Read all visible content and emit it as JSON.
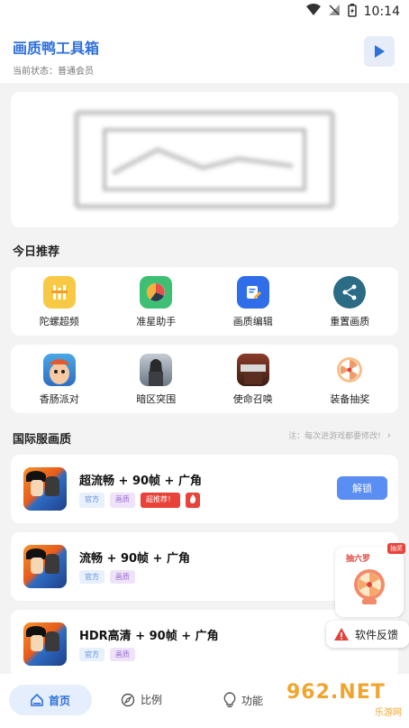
{
  "status_bar": {
    "time": "10:14"
  },
  "header": {
    "title": "画质鸭工具箱",
    "status": "当前状态：普通会员"
  },
  "sections": {
    "today": "今日推荐",
    "intl": "国际服画质",
    "intl_note": "注：每次进游戏都要修改!"
  },
  "tools_row1": [
    {
      "label": "陀螺超频",
      "icon": "gyro-icon",
      "color": "#f7c945"
    },
    {
      "label": "准星助手",
      "icon": "crosshair-pie-icon",
      "color": "#3ebf74"
    },
    {
      "label": "画质编辑",
      "icon": "edit-icon",
      "color": "#2f6ee8"
    },
    {
      "label": "重置画质",
      "icon": "share-reset-icon",
      "color": "#2b6b86"
    }
  ],
  "tools_row2": [
    {
      "label": "香肠派对",
      "icon": "sausage-party-game-icon"
    },
    {
      "label": "暗区突围",
      "icon": "arena-breakout-game-icon"
    },
    {
      "label": "使命召唤",
      "icon": "call-of-duty-game-icon"
    },
    {
      "label": "装备抽奖",
      "icon": "lottery-wheel-icon"
    }
  ],
  "games": [
    {
      "name": "超流畅 + 90帧 + 广角",
      "tags": [
        "官方",
        "画质",
        "超推荐！"
      ],
      "hot": true,
      "button": "解锁"
    },
    {
      "name": "流畅 + 90帧 + 广角",
      "tags": [
        "官方",
        "画质"
      ],
      "hot": false,
      "button": ""
    },
    {
      "name": "HDR高清 + 90帧 + 广角",
      "tags": [
        "官方",
        "画质"
      ],
      "hot": false,
      "button": ""
    }
  ],
  "floats": {
    "lottery": "抽六罗",
    "lottery_badge": "抽奖",
    "feedback": "软件反馈"
  },
  "nav": {
    "home": "首页",
    "ratio": "比例",
    "func": "功能"
  },
  "watermark": {
    "top": "962.NET",
    "bottom": "乐游网"
  },
  "colors": {
    "accent": "#2e6fd9",
    "button": "#5b8ef2",
    "hot": "#e7433b"
  }
}
